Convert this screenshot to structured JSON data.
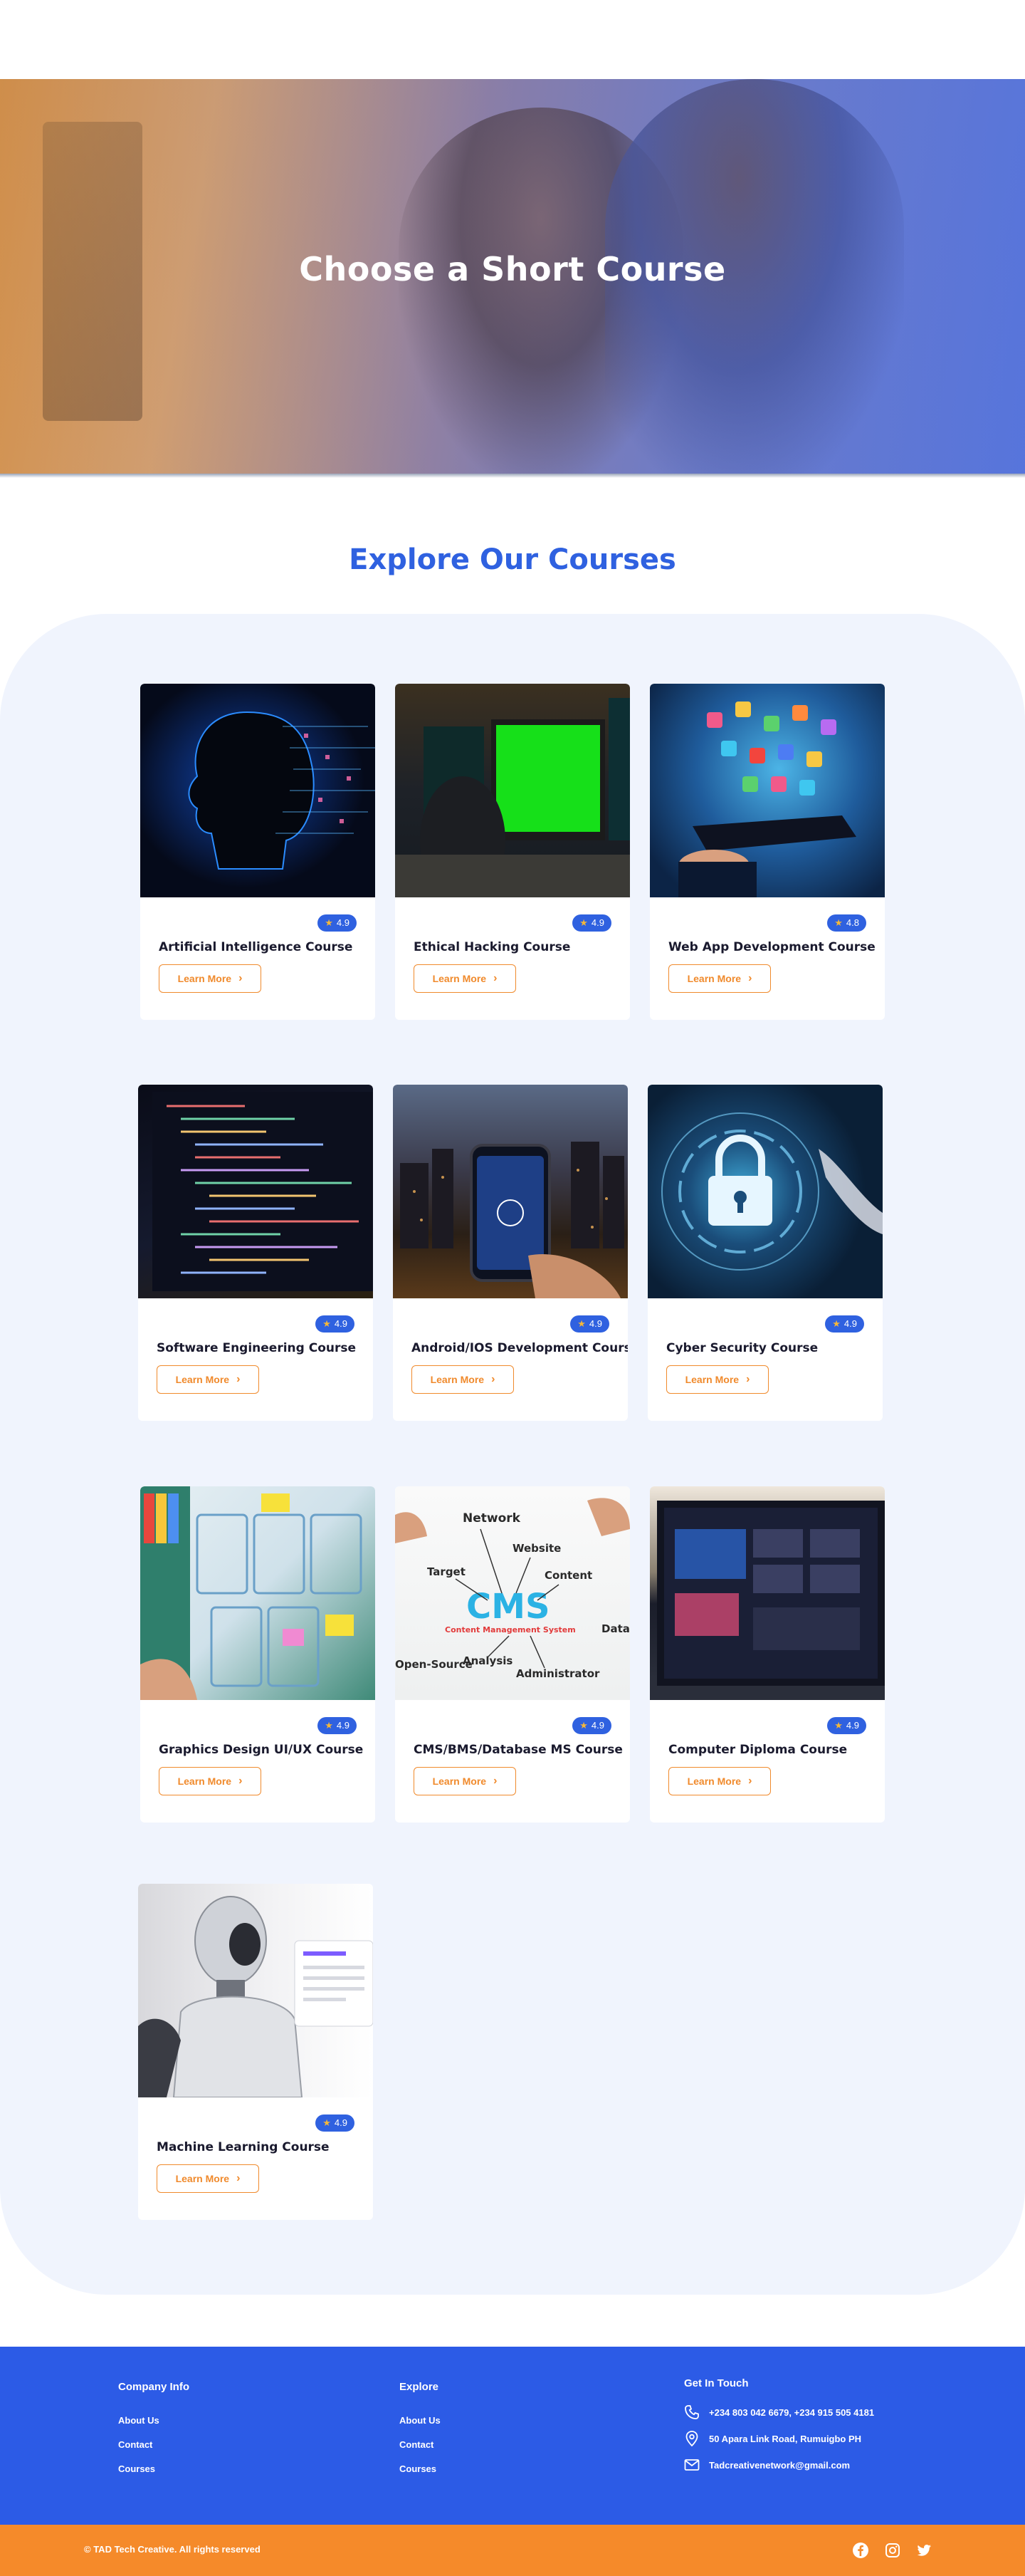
{
  "hero": {
    "title": "Choose a Short Course"
  },
  "section": {
    "title": "Explore Our Courses"
  },
  "courses": [
    {
      "title": "Artificial Intelligence Course",
      "rating": "4.9",
      "cta": "Learn More",
      "image_icon": "ai-head-image"
    },
    {
      "title": "Ethical Hacking Course",
      "rating": "4.9",
      "cta": "Learn More",
      "image_icon": "hacker-monitors-image"
    },
    {
      "title": "Web App Development Course",
      "rating": "4.8",
      "cta": "Learn More",
      "image_icon": "laptop-apps-image"
    },
    {
      "title": "Software Engineering Course",
      "rating": "4.9",
      "cta": "Learn More",
      "image_icon": "code-screen-image"
    },
    {
      "title": "Android/IOS Development Course",
      "rating": "4.9",
      "cta": "Learn More",
      "image_icon": "smartphone-city-image"
    },
    {
      "title": "Cyber Security Course",
      "rating": "4.9",
      "cta": "Learn More",
      "image_icon": "padlock-image"
    },
    {
      "title": "Graphics Design UI/UX Course",
      "rating": "4.9",
      "cta": "Learn More",
      "image_icon": "wireframe-sketch-image"
    },
    {
      "title": "CMS/BMS/Database MS Course",
      "rating": "4.9",
      "cta": "Learn More",
      "image_icon": "cms-diagram-image"
    },
    {
      "title": "Computer Diploma Course",
      "rating": "4.9",
      "cta": "Learn More",
      "image_icon": "desktop-monitor-image"
    },
    {
      "title": "Machine Learning Course",
      "rating": "4.9",
      "cta": "Learn More",
      "image_icon": "robot-image"
    }
  ],
  "cms_image": {
    "labels": [
      "Network",
      "Website",
      "Target",
      "Content",
      "CMS",
      "Content Management System",
      "Data",
      "Open-Source",
      "Analysis",
      "Administrator"
    ]
  },
  "footer": {
    "company": {
      "title": "Company Info",
      "links": [
        "About Us",
        "Contact",
        "Courses"
      ]
    },
    "explore": {
      "title": "Explore",
      "links": [
        "About Us",
        "Contact",
        "Courses"
      ]
    },
    "contact": {
      "title": "Get In Touch",
      "phone": "+234 803 042 6679, +234 915 505 4181",
      "address": "50 Apara Link Road, Rumuigbo PH",
      "email": "Tadcreativenetwork@gmail.com"
    },
    "copyright": "TAD Tech Creative. All rights reserved",
    "social": [
      "facebook-icon",
      "instagram-icon",
      "twitter-icon"
    ]
  },
  "colors": {
    "primary": "#2f61e0",
    "accent": "#f08a2c",
    "footer": "#2c5be6",
    "copybar": "#f58a2a",
    "panel": "#f0f4fd"
  }
}
